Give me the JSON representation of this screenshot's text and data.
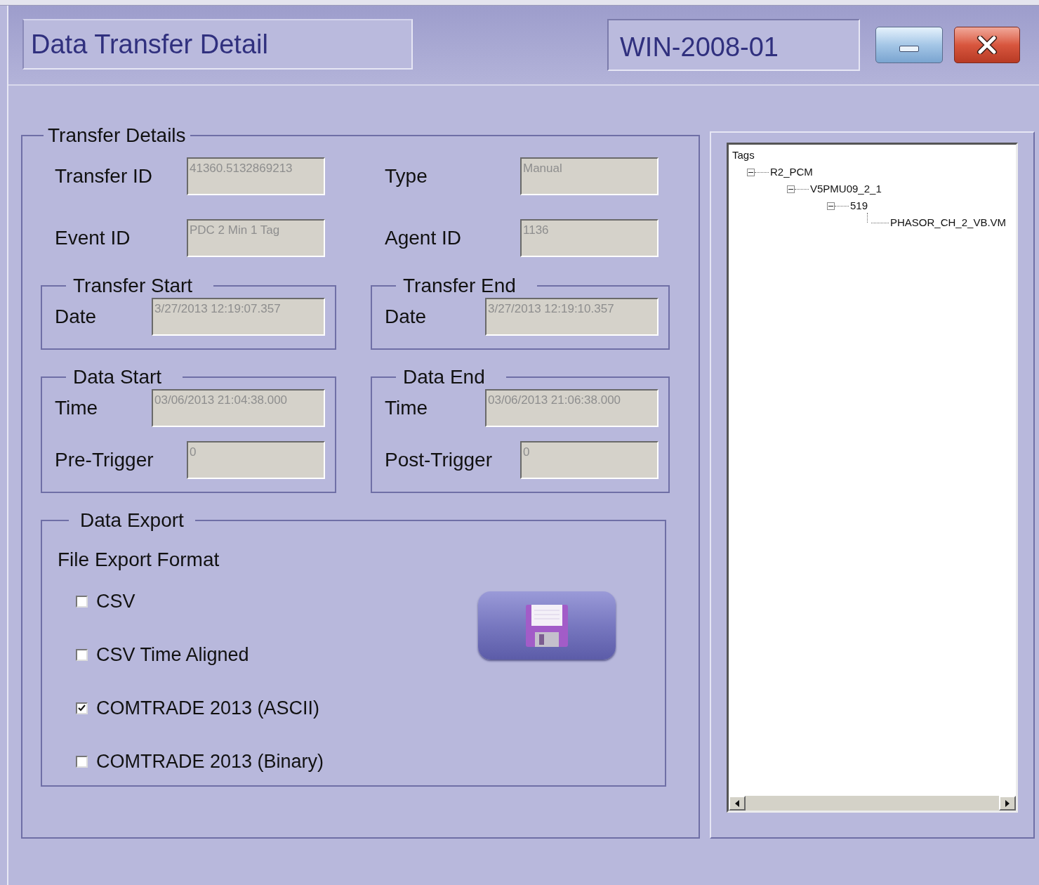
{
  "window": {
    "title": "Data Transfer Detail",
    "host": "WIN-2008-01"
  },
  "transfer_details": {
    "title": "Transfer Details",
    "fields": [
      {
        "label": "Transfer ID",
        "value": "41360.5132869213"
      },
      {
        "label": "Type",
        "value": "Manual"
      },
      {
        "label": "Event ID",
        "value": "PDC 2 Min 1 Tag"
      },
      {
        "label": "Agent ID",
        "value": "1136"
      }
    ],
    "groups": [
      {
        "title": "Transfer Start",
        "fields": [
          {
            "label": "Date",
            "value": "3/27/2013 12:19:07.357",
            "kind": "wide"
          }
        ]
      },
      {
        "title": "Transfer End",
        "fields": [
          {
            "label": "Date",
            "value": "3/27/2013 12:19:10.357",
            "kind": "wide"
          }
        ]
      },
      {
        "title": "Data Start",
        "fields": [
          {
            "label": "Time",
            "value": "03/06/2013 21:04:38.000",
            "kind": "wide"
          },
          {
            "label": "Pre-Trigger",
            "value": "0",
            "kind": "narrow"
          }
        ]
      },
      {
        "title": "Data End",
        "fields": [
          {
            "label": "Time",
            "value": "03/06/2013 21:06:38.000",
            "kind": "wide"
          },
          {
            "label": "Post-Trigger",
            "value": "0",
            "kind": "narrow"
          }
        ]
      }
    ],
    "data_export": {
      "title": "Data Export",
      "subtitle": "File Export Format",
      "options": [
        {
          "label": "CSV",
          "checked": false
        },
        {
          "label": "CSV Time Aligned",
          "checked": false
        },
        {
          "label": "COMTRADE 2013 (ASCII)",
          "checked": true
        },
        {
          "label": "COMTRADE 2013 (Binary)",
          "checked": false
        }
      ]
    }
  },
  "tree": {
    "label": "Tags",
    "children": [
      {
        "label": "R2_PCM",
        "expanded": true,
        "children": [
          {
            "label": "V5PMU09_2_1",
            "expanded": true,
            "children": [
              {
                "label": "519",
                "expanded": true,
                "children": [
                  {
                    "label": "PHASOR_CH_2_VB.VM"
                  }
                ]
              }
            ]
          }
        ]
      }
    ]
  }
}
